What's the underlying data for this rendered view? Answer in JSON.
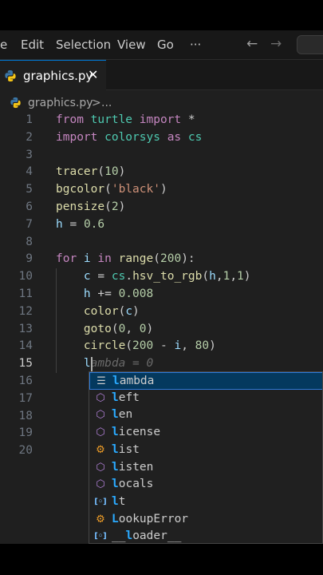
{
  "menu": {
    "items": [
      {
        "label": "e"
      },
      {
        "label": "Edit"
      },
      {
        "label": "Selection"
      },
      {
        "label": "View"
      },
      {
        "label": "Go"
      },
      {
        "label": "···"
      }
    ],
    "back_icon": "arrow-left-icon",
    "forward_icon": "arrow-right-icon"
  },
  "tab": {
    "label": "graphics.py",
    "close": "✕",
    "icon": "python-icon"
  },
  "breadcrumb": {
    "file": "graphics.py",
    "separator": ">",
    "more": "..."
  },
  "editor": {
    "current_line": 15,
    "line_numbers": [
      "1",
      "2",
      "3",
      "4",
      "5",
      "6",
      "7",
      "8",
      "9",
      "10",
      "11",
      "12",
      "13",
      "14",
      "15",
      "16",
      "17",
      "18",
      "19",
      "20"
    ],
    "lines": [
      [
        {
          "t": "from ",
          "c": "kw"
        },
        {
          "t": "turtle ",
          "c": "mod"
        },
        {
          "t": "import ",
          "c": "kw"
        },
        {
          "t": "*",
          "c": ""
        }
      ],
      [
        {
          "t": "import ",
          "c": "kw"
        },
        {
          "t": "colorsys ",
          "c": "mod"
        },
        {
          "t": "as ",
          "c": "kw"
        },
        {
          "t": "cs",
          "c": "mod"
        }
      ],
      [],
      [
        {
          "t": "tracer",
          "c": "fn"
        },
        {
          "t": "(",
          "c": ""
        },
        {
          "t": "10",
          "c": "nm"
        },
        {
          "t": ")",
          "c": ""
        }
      ],
      [
        {
          "t": "bgcolor",
          "c": "fn"
        },
        {
          "t": "(",
          "c": ""
        },
        {
          "t": "'black'",
          "c": "st"
        },
        {
          "t": ")",
          "c": ""
        }
      ],
      [
        {
          "t": "pensize",
          "c": "fn"
        },
        {
          "t": "(",
          "c": ""
        },
        {
          "t": "2",
          "c": "nm"
        },
        {
          "t": ")",
          "c": ""
        }
      ],
      [
        {
          "t": "h",
          "c": "var"
        },
        {
          "t": " = ",
          "c": ""
        },
        {
          "t": "0.6",
          "c": "nm"
        }
      ],
      [],
      [
        {
          "t": "for ",
          "c": "kw"
        },
        {
          "t": "i ",
          "c": "var"
        },
        {
          "t": "in ",
          "c": "kw"
        },
        {
          "t": "range",
          "c": "fn"
        },
        {
          "t": "(",
          "c": ""
        },
        {
          "t": "200",
          "c": "nm"
        },
        {
          "t": "):",
          "c": ""
        }
      ],
      [
        {
          "t": "    ",
          "c": ""
        },
        {
          "t": "c",
          "c": "var"
        },
        {
          "t": " = ",
          "c": ""
        },
        {
          "t": "cs",
          "c": "mod"
        },
        {
          "t": ".",
          "c": ""
        },
        {
          "t": "hsv_to_rgb",
          "c": "fn"
        },
        {
          "t": "(",
          "c": ""
        },
        {
          "t": "h",
          "c": "var"
        },
        {
          "t": ",",
          "c": ""
        },
        {
          "t": "1",
          "c": "nm"
        },
        {
          "t": ",",
          "c": ""
        },
        {
          "t": "1",
          "c": "nm"
        },
        {
          "t": ")",
          "c": ""
        }
      ],
      [
        {
          "t": "    ",
          "c": ""
        },
        {
          "t": "h",
          "c": "var"
        },
        {
          "t": " += ",
          "c": ""
        },
        {
          "t": "0.008",
          "c": "nm"
        }
      ],
      [
        {
          "t": "    ",
          "c": ""
        },
        {
          "t": "color",
          "c": "fn"
        },
        {
          "t": "(",
          "c": ""
        },
        {
          "t": "c",
          "c": "var"
        },
        {
          "t": ")",
          "c": ""
        }
      ],
      [
        {
          "t": "    ",
          "c": ""
        },
        {
          "t": "goto",
          "c": "fn"
        },
        {
          "t": "(",
          "c": ""
        },
        {
          "t": "0",
          "c": "nm"
        },
        {
          "t": ", ",
          "c": ""
        },
        {
          "t": "0",
          "c": "nm"
        },
        {
          "t": ")",
          "c": ""
        }
      ],
      [
        {
          "t": "    ",
          "c": ""
        },
        {
          "t": "circle",
          "c": "fn"
        },
        {
          "t": "(",
          "c": ""
        },
        {
          "t": "200",
          "c": "nm"
        },
        {
          "t": " - ",
          "c": ""
        },
        {
          "t": "i",
          "c": "var"
        },
        {
          "t": ", ",
          "c": ""
        },
        {
          "t": "80",
          "c": "nm"
        },
        {
          "t": ")",
          "c": ""
        }
      ],
      [
        {
          "t": "    ",
          "c": ""
        },
        {
          "t": "l",
          "c": "var"
        },
        {
          "t": "ambda = 0",
          "c": "ghost"
        }
      ],
      [],
      [],
      [],
      [],
      []
    ]
  },
  "suggestions": {
    "typed": "l",
    "items": [
      {
        "label": "lambda",
        "icon": "keyword-icon",
        "selected": true
      },
      {
        "label": "left",
        "icon": "function-icon"
      },
      {
        "label": "len",
        "icon": "function-icon"
      },
      {
        "label": "license",
        "icon": "function-icon"
      },
      {
        "label": "list",
        "icon": "class-icon"
      },
      {
        "label": "listen",
        "icon": "function-icon"
      },
      {
        "label": "locals",
        "icon": "function-icon"
      },
      {
        "label": "lt",
        "icon": "variable-icon"
      },
      {
        "label": "LookupError",
        "icon": "class-icon"
      },
      {
        "label": "__loader__",
        "icon": "variable-icon"
      }
    ]
  },
  "colors": {
    "keyword": "#c586c0",
    "function": "#dcdcaa",
    "number": "#b5cea8",
    "string": "#ce9178",
    "variable": "#9cdcfe",
    "module": "#4ec9b0",
    "accent": "#0078d4",
    "match": "#2aaaff"
  }
}
